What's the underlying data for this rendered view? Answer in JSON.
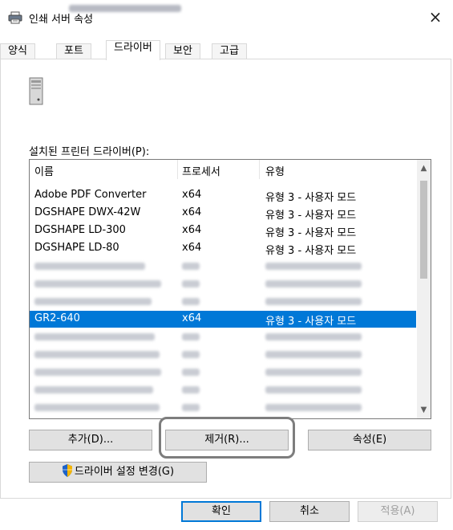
{
  "window": {
    "title": "인쇄 서버 속성",
    "close_label": "×"
  },
  "tabs": [
    {
      "label": "양식"
    },
    {
      "label": "포트"
    },
    {
      "label": "드라이버"
    },
    {
      "label": "보안"
    },
    {
      "label": "고급"
    }
  ],
  "active_tab": "드라이버",
  "drivers_section": {
    "label": "설치된 프린터 드라이버(P):",
    "columns": [
      "이름",
      "프로세서",
      "유형"
    ],
    "rows": [
      {
        "name": "Adobe PDF Converter",
        "processor": "x64",
        "type": "유형 3 - 사용자 모드"
      },
      {
        "name": "DGSHAPE DWX-42W",
        "processor": "x64",
        "type": "유형 3 - 사용자 모드"
      },
      {
        "name": "DGSHAPE LD-300",
        "processor": "x64",
        "type": "유형 3 - 사용자 모드"
      },
      {
        "name": "DGSHAPE LD-80",
        "processor": "x64",
        "type": "유형 3 - 사용자 모드"
      },
      {
        "name": "GR2-640",
        "processor": "x64",
        "type": "유형 3 - 사용자 모드",
        "selected": true
      }
    ]
  },
  "buttons": {
    "add": "추가(D)...",
    "remove": "제거(R)...",
    "properties": "속성(E)",
    "change_driver_settings": "드라이버 설정 변경(G)",
    "ok": "확인",
    "cancel": "취소",
    "apply": "적용(A)"
  },
  "colors": {
    "selection": "#0078d7",
    "highlight_ring": "#7d7d7d"
  }
}
